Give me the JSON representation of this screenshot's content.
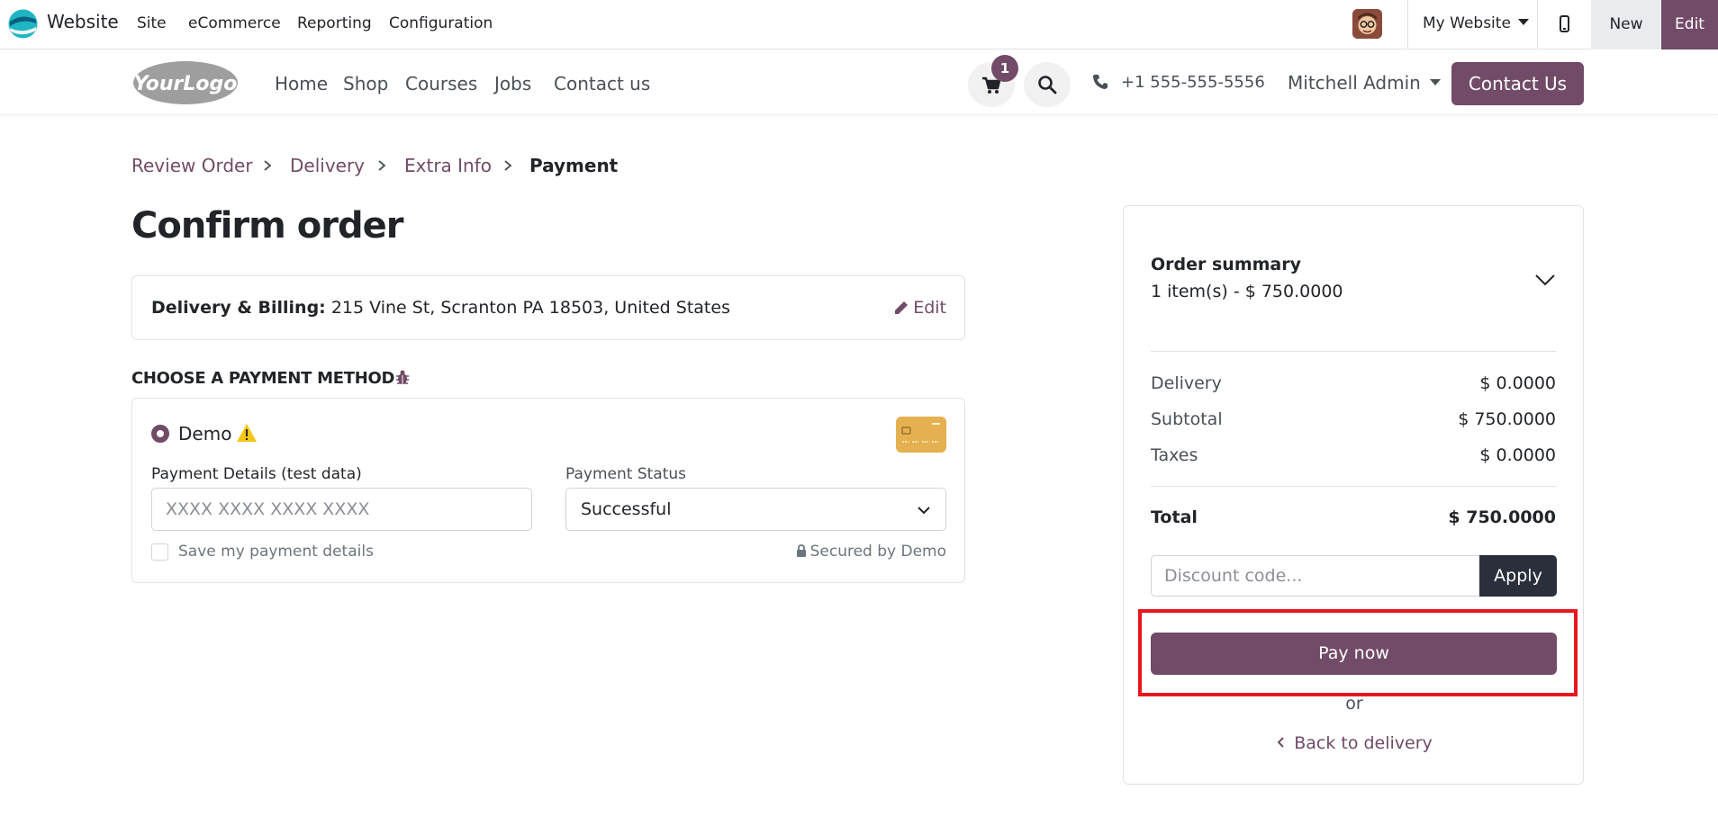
{
  "topbar": {
    "app_name": "Website",
    "menu": [
      "Site",
      "eCommerce",
      "Reporting",
      "Configuration"
    ],
    "website_selector": "My Website",
    "new_label": "New",
    "edit_label": "Edit"
  },
  "header": {
    "logo_text": "YourLogo",
    "nav": [
      "Home",
      "Shop",
      "Courses",
      "Jobs",
      "Contact us"
    ],
    "cart_count": "1",
    "phone": "+1 555-555-5556",
    "user": "Mitchell Admin",
    "contact_button": "Contact Us"
  },
  "breadcrumb": {
    "steps": [
      "Review Order",
      "Delivery",
      "Extra Info",
      "Payment"
    ]
  },
  "page": {
    "title": "Confirm order"
  },
  "address": {
    "label": "Delivery & Billing:",
    "value": "215 Vine St, Scranton PA 18503, United States",
    "edit_label": "Edit"
  },
  "payment": {
    "heading": "CHOOSE A PAYMENT METHOD",
    "method_name": "Demo",
    "details_label": "Payment Details (test data)",
    "details_placeholder": "XXXX XXXX XXXX XXXX",
    "status_label": "Payment Status",
    "status_value": "Successful",
    "save_label": "Save my payment details",
    "secured_label": "Secured by Demo"
  },
  "summary": {
    "title": "Order summary",
    "items_line": "1 item(s) -  $ 750.0000",
    "rows": [
      {
        "label": "Delivery",
        "value": "$ 0.0000"
      },
      {
        "label": "Subtotal",
        "value": "$ 750.0000"
      },
      {
        "label": "Taxes",
        "value": "$ 0.0000"
      }
    ],
    "total_label": "Total",
    "total_value": "$ 750.0000",
    "discount_placeholder": "Discount code...",
    "apply_label": "Apply",
    "pay_label": "Pay now",
    "or_label": "or",
    "back_label": "Back to delivery"
  },
  "colors": {
    "brand": "#714b67",
    "highlight": "#e8161e",
    "apply_bg": "#2b2f3c"
  }
}
